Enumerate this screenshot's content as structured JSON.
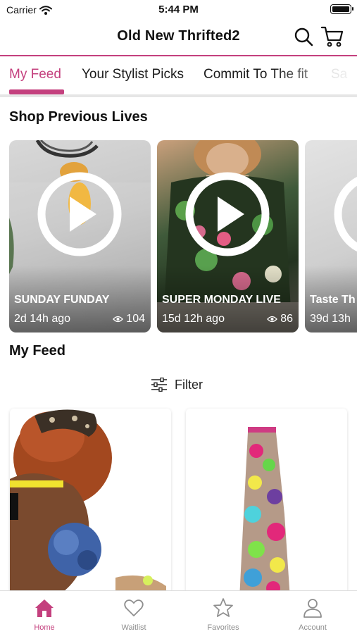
{
  "status_bar": {
    "carrier": "Carrier",
    "time": "5:44 PM"
  },
  "header": {
    "title": "Old New Thrifted2"
  },
  "tabs": [
    {
      "label": "My Feed",
      "active": true
    },
    {
      "label": "Your Stylist Picks",
      "active": false
    },
    {
      "label": "Commit To The fit",
      "active": false
    },
    {
      "label": "Sa",
      "active": false
    }
  ],
  "sections": {
    "lives_title": "Shop Previous Lives",
    "feed_title": "My Feed"
  },
  "lives": [
    {
      "name": "SUNDAY FUNDAY",
      "age": "2d 14h ago",
      "views": "104"
    },
    {
      "name": "SUPER MONDAY LIVE",
      "age": "15d 12h ago",
      "views": "86"
    },
    {
      "name": "Taste Th",
      "age": "39d 13h",
      "views": ""
    }
  ],
  "filter": {
    "label": "Filter"
  },
  "tabbar": [
    {
      "label": "Home",
      "icon": "home-icon",
      "active": true
    },
    {
      "label": "Waitlist",
      "icon": "heart-icon",
      "active": false
    },
    {
      "label": "Favorites",
      "icon": "star-icon",
      "active": false
    },
    {
      "label": "Account",
      "icon": "person-icon",
      "active": false
    }
  ],
  "colors": {
    "accent": "#c4407e",
    "inactive": "#8e8e8e"
  }
}
